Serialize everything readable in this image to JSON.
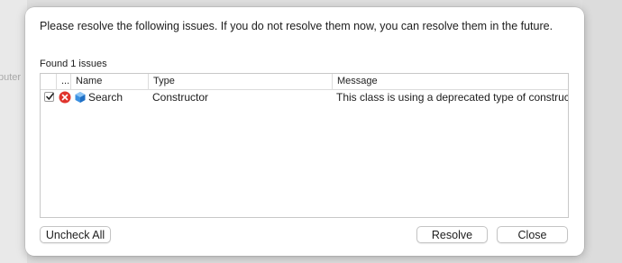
{
  "background": {
    "left_text": "puter"
  },
  "dialog": {
    "message": "Please resolve the following issues.  If you do not resolve them now, you can resolve them in the future.",
    "found_label": "Found 1 issues"
  },
  "table": {
    "columns": [
      "...",
      "Name",
      "Type",
      "Message"
    ],
    "rows": [
      {
        "checked": true,
        "status_icon": "error-x-icon",
        "item_icon": "cube-icon",
        "name": "Search",
        "type": "Constructor",
        "message": "This class is using a deprecated type of construc..."
      }
    ]
  },
  "buttons": {
    "uncheck_all": "Uncheck All",
    "resolve": "Resolve",
    "close": "Close"
  },
  "colors": {
    "error_red": "#e0332c",
    "cube_blue": "#3a8fe0"
  }
}
